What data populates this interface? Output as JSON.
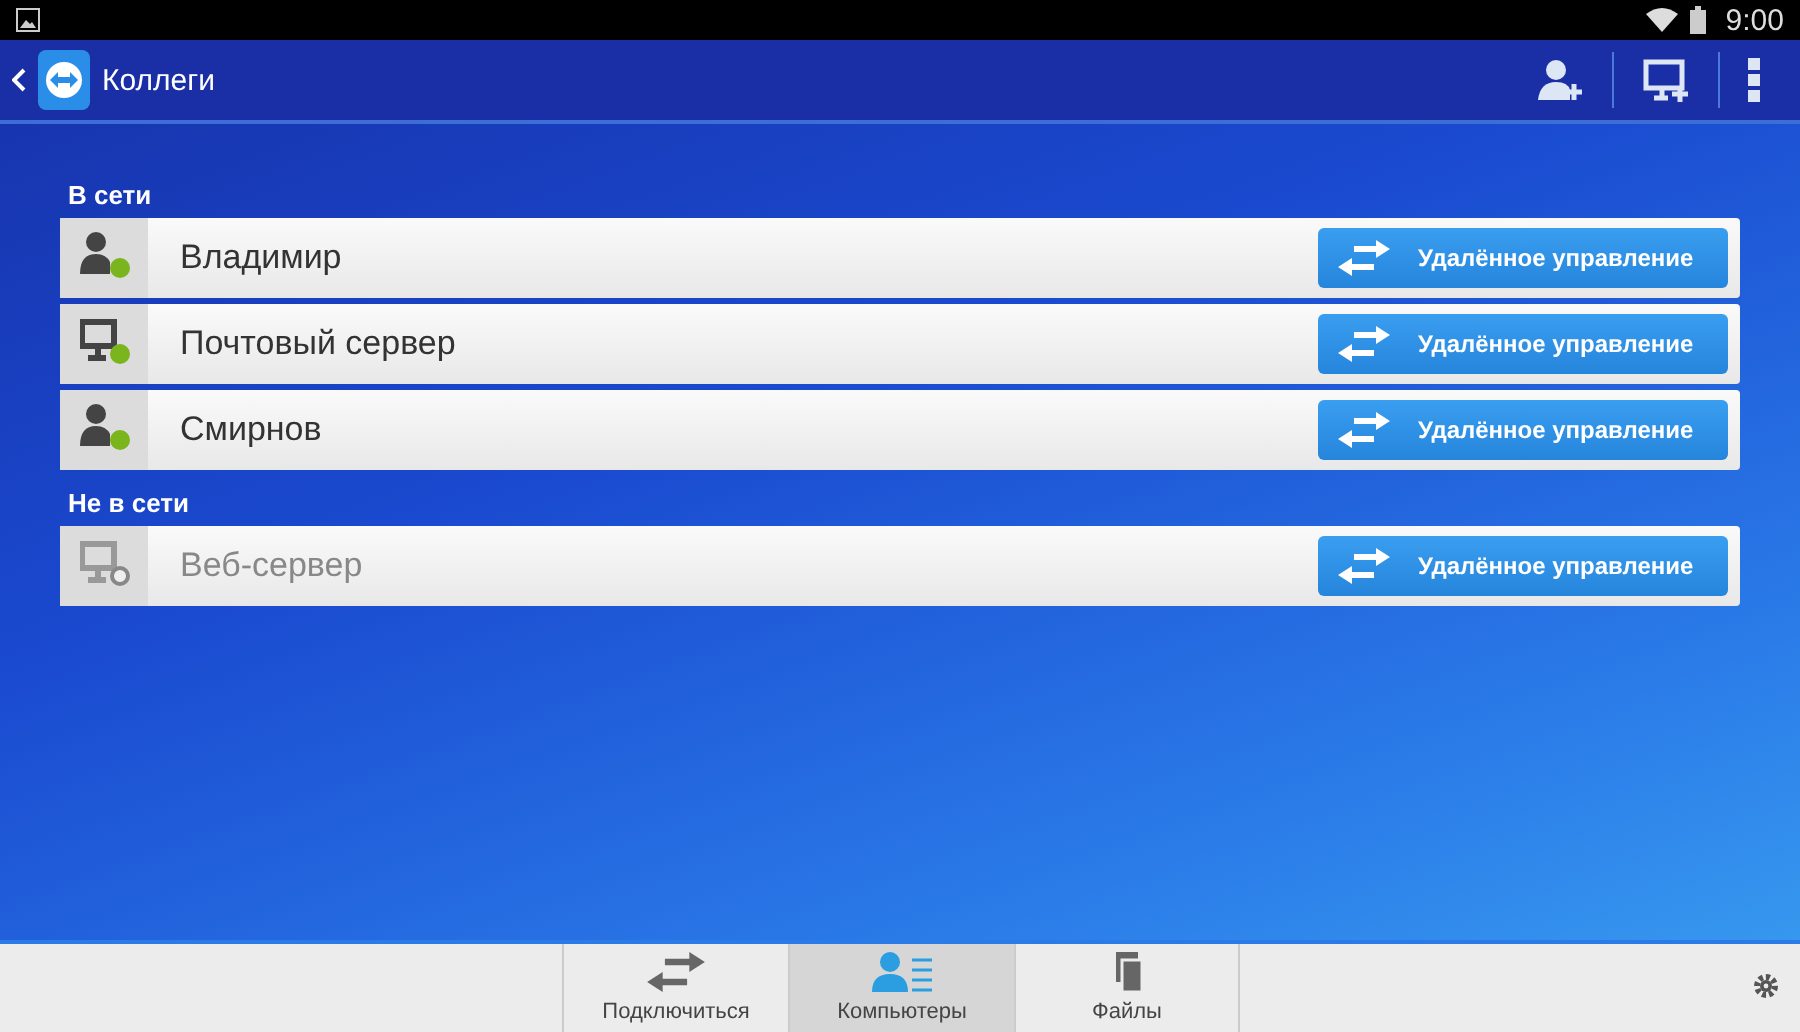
{
  "status_bar": {
    "time": "9:00"
  },
  "action_bar": {
    "title": "Коллеги"
  },
  "groups": [
    {
      "title": "В сети",
      "items": [
        {
          "kind": "person",
          "name": "Владимир",
          "online": true,
          "action": "Удалённое управление"
        },
        {
          "kind": "computer",
          "name": "Почтовый сервер",
          "online": true,
          "action": "Удалённое управление"
        },
        {
          "kind": "person",
          "name": "Смирнов",
          "online": true,
          "action": "Удалённое управление"
        }
      ]
    },
    {
      "title": "Не в сети",
      "items": [
        {
          "kind": "computer",
          "name": "Веб-сервер",
          "online": false,
          "action": "Удалённое управление"
        }
      ]
    }
  ],
  "bottom_tabs": [
    {
      "kind": "connect",
      "label": "Подключиться",
      "selected": false
    },
    {
      "kind": "computers",
      "label": "Компьютеры",
      "selected": true
    },
    {
      "kind": "files",
      "label": "Файлы",
      "selected": false
    }
  ]
}
